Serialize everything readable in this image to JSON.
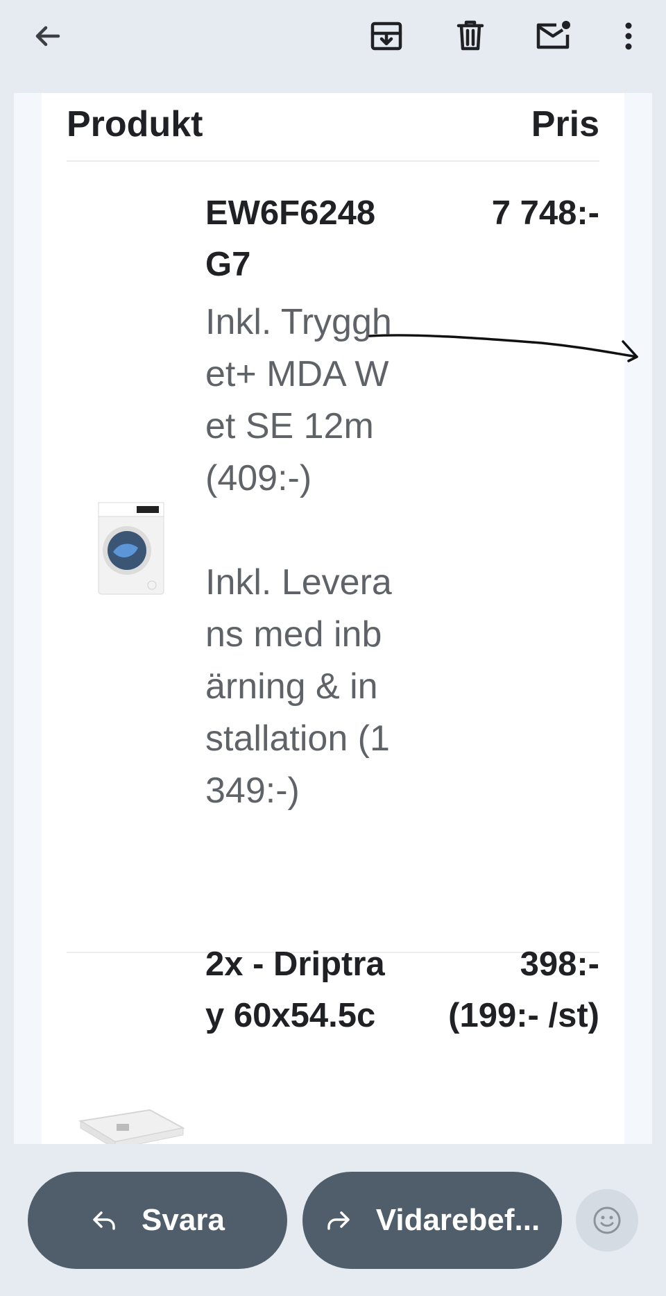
{
  "toolbar": {
    "icons": [
      "back-arrow-icon",
      "archive-icon",
      "delete-icon",
      "mark-unread-icon",
      "more-vert-icon"
    ]
  },
  "table": {
    "header_product": "Produkt",
    "header_price": "Pris"
  },
  "items": [
    {
      "name": "EW6F6248G7",
      "price": "7 748:-",
      "notes": [
        "Inkl. Trygghet+ MDA Wet SE 12m (409:-)",
        "Inkl. Leverans med inbärning & installation (1 349:-)"
      ],
      "image": "washing-machine-image"
    },
    {
      "name": "2x - Driptray 60x54.5c",
      "price": "398:-",
      "unit_price": "(199:- /st)",
      "image": "drip-tray-image"
    }
  ],
  "actions": {
    "reply_label": "Svara",
    "forward_label": "Vidarebef..."
  },
  "colors": {
    "background": "#e6ebf2",
    "button": "#4f5e6a",
    "text": "#202124",
    "muted_text": "#5f6368"
  }
}
